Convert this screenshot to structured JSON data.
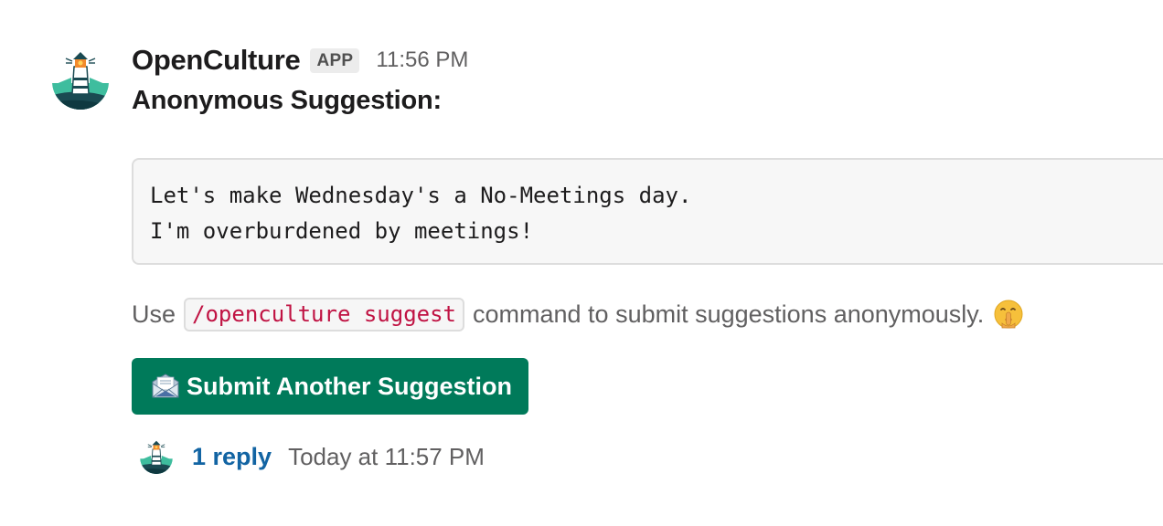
{
  "message": {
    "sender": "OpenCulture",
    "badge": "APP",
    "timestamp": "11:56 PM",
    "title": "Anonymous Suggestion:",
    "code_lines": [
      "Let's make Wednesday's a No-Meetings day.",
      "I'm overburdened by meetings!"
    ],
    "hint": {
      "prefix": "Use",
      "command": "/openculture suggest",
      "suffix": "command to submit suggestions anonymously.",
      "emoji_icon": "shushing-face-icon"
    },
    "button": {
      "icon": "envelope-icon",
      "label": "Submit Another Suggestion"
    },
    "thread": {
      "reply_count": "1 reply",
      "last_reply": "Today at 11:57 PM"
    }
  },
  "colors": {
    "button_bg": "#007a5a",
    "link": "#1264a3",
    "code_text": "#c01343",
    "muted_text": "#616061"
  }
}
